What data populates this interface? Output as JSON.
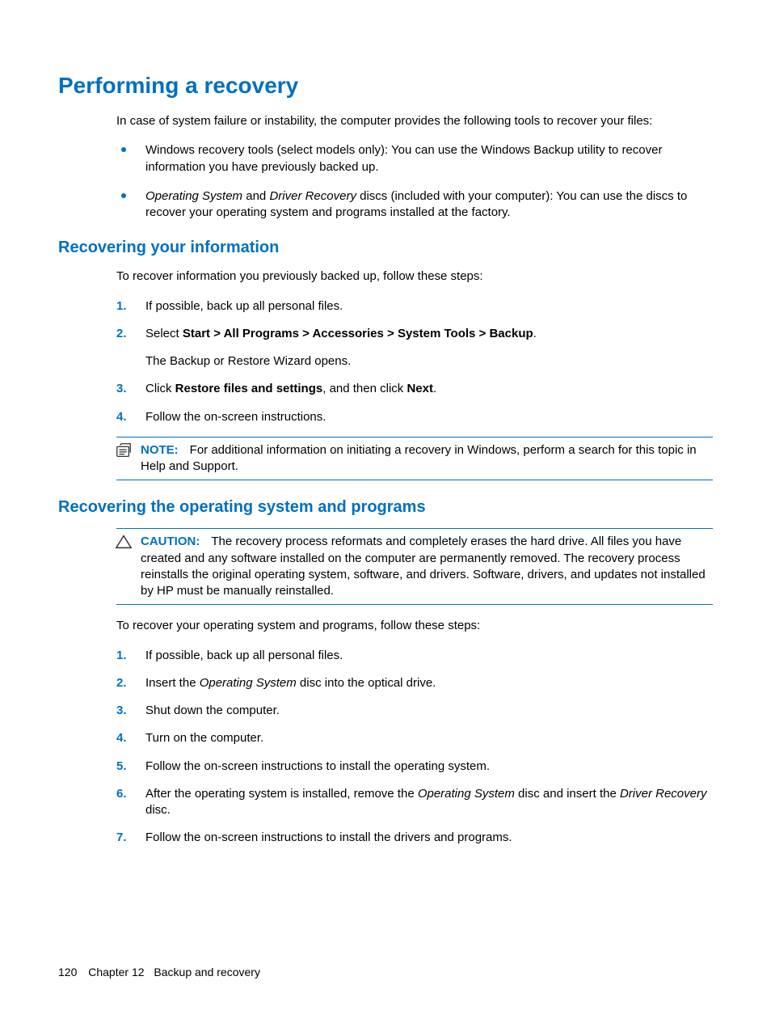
{
  "h1": "Performing a recovery",
  "intro": "In case of system failure or instability, the computer provides the following tools to recover your files:",
  "bullets": [
    {
      "pre": "Windows recovery tools (select models only): You can use the Windows Backup utility to recover information you have previously backed up."
    },
    {
      "i1": "Operating System",
      "mid1": " and ",
      "i2": "Driver Recovery",
      "rest": " discs (included with your computer): You can use the discs to recover your operating system and programs installed at the factory."
    }
  ],
  "section1": {
    "title": "Recovering your information",
    "intro": "To recover information you previously backed up, follow these steps:",
    "steps": [
      {
        "n": "1.",
        "text": "If possible, back up all personal files."
      },
      {
        "n": "2.",
        "pre": "Select ",
        "bold": "Start > All Programs > Accessories > System Tools > Backup",
        "post": ".",
        "sub": "The Backup or Restore Wizard opens."
      },
      {
        "n": "3.",
        "pre": "Click ",
        "bold": "Restore files and settings",
        "mid": ", and then click ",
        "bold2": "Next",
        "post": "."
      },
      {
        "n": "4.",
        "text": "Follow the on-screen instructions."
      }
    ],
    "note_label": "NOTE:",
    "note_text": "For additional information on initiating a recovery in Windows, perform a search for this topic in Help and Support."
  },
  "section2": {
    "title": "Recovering the operating system and programs",
    "caution_label": "CAUTION:",
    "caution_text": "The recovery process reformats and completely erases the hard drive. All files you have created and any software installed on the computer are permanently removed. The recovery process reinstalls the original operating system, software, and drivers. Software, drivers, and updates not installed by HP must be manually reinstalled.",
    "intro": "To recover your operating system and programs, follow these steps:",
    "steps": [
      {
        "n": "1.",
        "text": "If possible, back up all personal files."
      },
      {
        "n": "2.",
        "pre": "Insert the ",
        "i1": "Operating System",
        "post": " disc into the optical drive."
      },
      {
        "n": "3.",
        "text": "Shut down the computer."
      },
      {
        "n": "4.",
        "text": "Turn on the computer."
      },
      {
        "n": "5.",
        "text": "Follow the on-screen instructions to install the operating system."
      },
      {
        "n": "6.",
        "pre": "After the operating system is installed, remove the ",
        "i1": "Operating System",
        "mid": " disc and insert the ",
        "i2": "Driver Recovery",
        "post": " disc."
      },
      {
        "n": "7.",
        "text": "Follow the on-screen instructions to install the drivers and programs."
      }
    ]
  },
  "footer": {
    "page": "120",
    "chapter": "Chapter 12",
    "title": "Backup and recovery"
  }
}
